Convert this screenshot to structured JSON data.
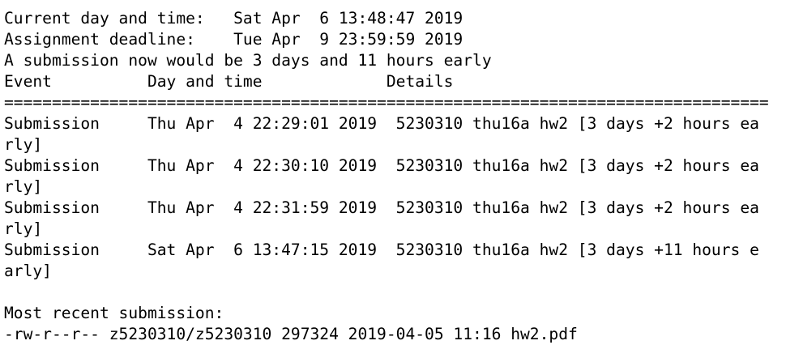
{
  "terminal": {
    "lines": [
      "Current day and time:   Sat Apr  6 13:48:47 2019",
      "Assignment deadline:    Tue Apr  9 23:59:59 2019",
      "A submission now would be 3 days and 11 hours early",
      "Event          Day and time             Details",
      "================================================================================",
      "Submission     Thu Apr  4 22:29:01 2019  5230310 thu16a hw2 [3 days +2 hours ea",
      "rly]",
      "Submission     Thu Apr  4 22:30:10 2019  5230310 thu16a hw2 [3 days +2 hours ea",
      "rly]",
      "Submission     Thu Apr  4 22:31:59 2019  5230310 thu16a hw2 [3 days +2 hours ea",
      "rly]",
      "Submission     Sat Apr  6 13:47:15 2019  5230310 thu16a hw2 [3 days +11 hours e",
      "arly]",
      "",
      "Most recent submission:",
      "-rw-r--r-- z5230310/z5230310 297324 2019-04-05 11:16 hw2.pdf"
    ]
  }
}
